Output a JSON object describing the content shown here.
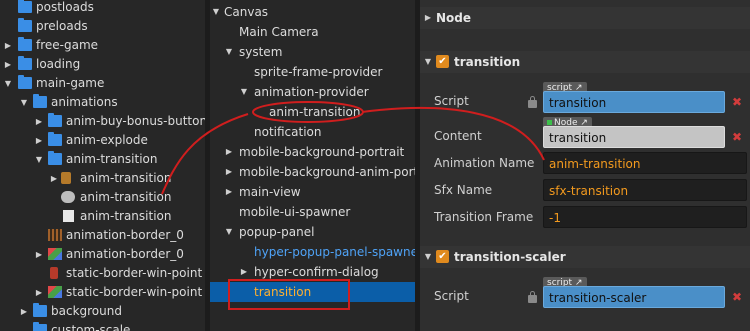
{
  "assets": {
    "items": [
      {
        "label": "postloads",
        "icon": "folder-icon"
      },
      {
        "label": "preloads",
        "icon": "folder-icon"
      },
      {
        "label": "free-game",
        "icon": "folder-icon"
      },
      {
        "label": "loading",
        "icon": "folder-icon"
      },
      {
        "label": "main-game",
        "icon": "folder-icon"
      },
      {
        "label": "animations",
        "icon": "folder-icon"
      },
      {
        "label": "anim-buy-bonus-button",
        "icon": "folder-icon"
      },
      {
        "label": "anim-explode",
        "icon": "folder-icon"
      },
      {
        "label": "anim-transition",
        "icon": "folder-icon"
      },
      {
        "label": "anim-transition",
        "icon": "sprite-icon"
      },
      {
        "label": "anim-transition",
        "icon": "animation-clip-icon"
      },
      {
        "label": "anim-transition",
        "icon": "file-icon"
      },
      {
        "label": "animation-border_0",
        "icon": "spritesheet-icon"
      },
      {
        "label": "animation-border_0",
        "icon": "image-icon"
      },
      {
        "label": "static-border-win-point",
        "icon": "sprite-icon"
      },
      {
        "label": "static-border-win-point",
        "icon": "image-icon"
      },
      {
        "label": "background",
        "icon": "folder-icon"
      },
      {
        "label": "custom-scale",
        "icon": "folder-icon"
      }
    ]
  },
  "hierarchy": {
    "items": [
      {
        "label": "Canvas"
      },
      {
        "label": "Main Camera"
      },
      {
        "label": "system"
      },
      {
        "label": "sprite-frame-provider"
      },
      {
        "label": "animation-provider"
      },
      {
        "label": "anim-transition"
      },
      {
        "label": "notification"
      },
      {
        "label": "mobile-background-portrait"
      },
      {
        "label": "mobile-background-anim-portrait"
      },
      {
        "label": "main-view"
      },
      {
        "label": "mobile-ui-spawner"
      },
      {
        "label": "popup-panel"
      },
      {
        "label": "hyper-popup-panel-spawner"
      },
      {
        "label": "hyper-confirm-dialog"
      },
      {
        "label": "transition"
      }
    ]
  },
  "inspector": {
    "node_section": "Node",
    "transition_section": "transition",
    "script_label": "Script",
    "script_tag": "script",
    "script_value": "transition",
    "content_label": "Content",
    "node_tag": "Node",
    "content_value": "transition",
    "anim_name_label": "Animation Name",
    "anim_name_value": "anim-transition",
    "sfx_label": "Sfx Name",
    "sfx_value": "sfx-transition",
    "frame_label": "Transition Frame",
    "frame_value": "-1",
    "scaler_section": "transition-scaler",
    "scaler_script_label": "Script",
    "scaler_script_tag": "script",
    "scaler_script_value": "transition-scaler",
    "remove_glyph": "✖",
    "check_glyph": "✔"
  },
  "colors": {
    "annotation": "#d01e1e",
    "selection": "#0b5ea8",
    "accent": "#f39a1e",
    "prefab": "#4fa3f7"
  }
}
